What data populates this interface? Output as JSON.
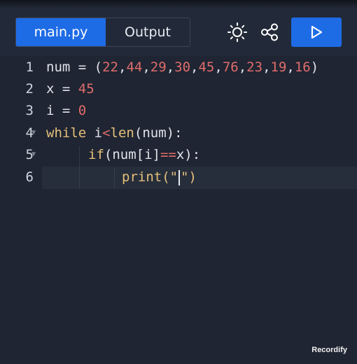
{
  "tabs": [
    {
      "label": "main.py",
      "active": true
    },
    {
      "label": "Output",
      "active": false
    }
  ],
  "toolbar": {
    "theme_icon": "sun-icon",
    "share_icon": "share-icon",
    "run_icon": "play-icon"
  },
  "editor": {
    "lines": [
      {
        "number": "1",
        "tokens": [
          "num",
          " = ",
          "(",
          "22",
          ",",
          "44",
          ",",
          "29",
          ",",
          "30",
          ",",
          "45",
          ",",
          "76",
          ",",
          "23",
          ",",
          "19",
          ",",
          "16",
          ")"
        ]
      },
      {
        "number": "2",
        "tokens": [
          "x",
          " = ",
          "45"
        ]
      },
      {
        "number": "3",
        "tokens": [
          "i",
          " = ",
          "0"
        ]
      },
      {
        "number": "4",
        "tokens": [
          "while",
          " i",
          "<",
          "len",
          "(num):"
        ]
      },
      {
        "number": "5",
        "tokens": [
          "if",
          "(num[i]",
          "==",
          "x):"
        ]
      },
      {
        "number": "6",
        "tokens": [
          "print",
          "(\"",
          "\")"
        ]
      }
    ]
  },
  "watermark": "Recordify",
  "colors": {
    "accent": "#1e6be6",
    "background": "#1f2532",
    "keyword": "#e5c07b",
    "number": "#e06c6c"
  }
}
